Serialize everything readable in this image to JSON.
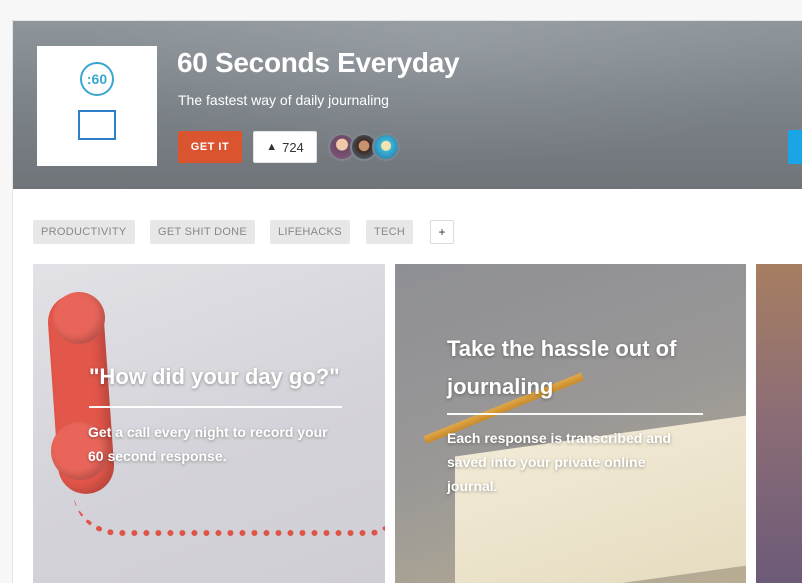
{
  "product": {
    "name": "60 Seconds Everyday",
    "tagline": "The fastest way of daily journaling",
    "logo_badge": ":60",
    "get_label": "GET IT",
    "upvote_icon": "▲",
    "upvote_count": "724",
    "accent_color": "#da552f",
    "side_button_color": "#1aa5e6"
  },
  "tags": {
    "items": [
      "PRODUCTIVITY",
      "GET SHIT DONE",
      "LIFEHACKS",
      "TECH"
    ],
    "more_label": "+"
  },
  "gallery": {
    "slides": [
      {
        "heading": "\"How did your day go?\"",
        "body": "Get a call every night to record your 60 second response."
      },
      {
        "heading": "Take the hassle out of journaling",
        "body": "Each response is transcribed and saved into your private online journal."
      }
    ]
  }
}
